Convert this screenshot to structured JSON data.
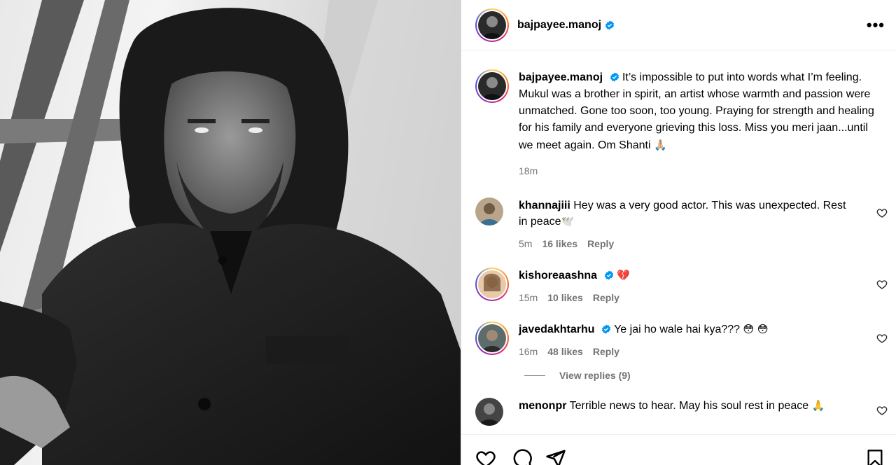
{
  "post": {
    "author": "bajpayee.manoj",
    "caption": "It’s impossible to put into words what I’m feeling. Mukul was a brother in spirit, an artist whose warmth and passion were unmatched. Gone too soon, too young. Praying for strength and healing for his family and everyone grieving this loss. Miss you meri jaan...until we meet again. Om Shanti",
    "caption_emoji": "🙏🏼",
    "time": "18m"
  },
  "comments": [
    {
      "user": "khannajiii",
      "text": "Hey was a very good actor. This was unexpected. Rest in peace",
      "emoji": "🕊️",
      "time": "5m",
      "likes": "16 likes",
      "reply": "Reply",
      "verified": false
    },
    {
      "user": "kishoreaashna",
      "text": "",
      "emoji": "💔",
      "time": "15m",
      "likes": "10 likes",
      "reply": "Reply",
      "verified": true
    },
    {
      "user": "javedakhtarhu",
      "text": "Ye jai ho wale hai kya???",
      "emoji": "😳 😳",
      "time": "16m",
      "likes": "48 likes",
      "reply": "Reply",
      "verified": true
    },
    {
      "user": "menonpr",
      "text": "Terrible news to hear. May his soul rest in peace",
      "emoji": "🙏",
      "time": "",
      "likes": "",
      "reply": "",
      "verified": false
    }
  ],
  "view_replies": "View replies (9)",
  "icons": {
    "more": "more-options-icon",
    "verified": "verified-badge-icon",
    "like": "heart-icon",
    "comment": "comment-icon",
    "share": "share-icon",
    "save": "bookmark-icon"
  },
  "colors": {
    "verified": "#0095f6",
    "meta": "#737373"
  }
}
